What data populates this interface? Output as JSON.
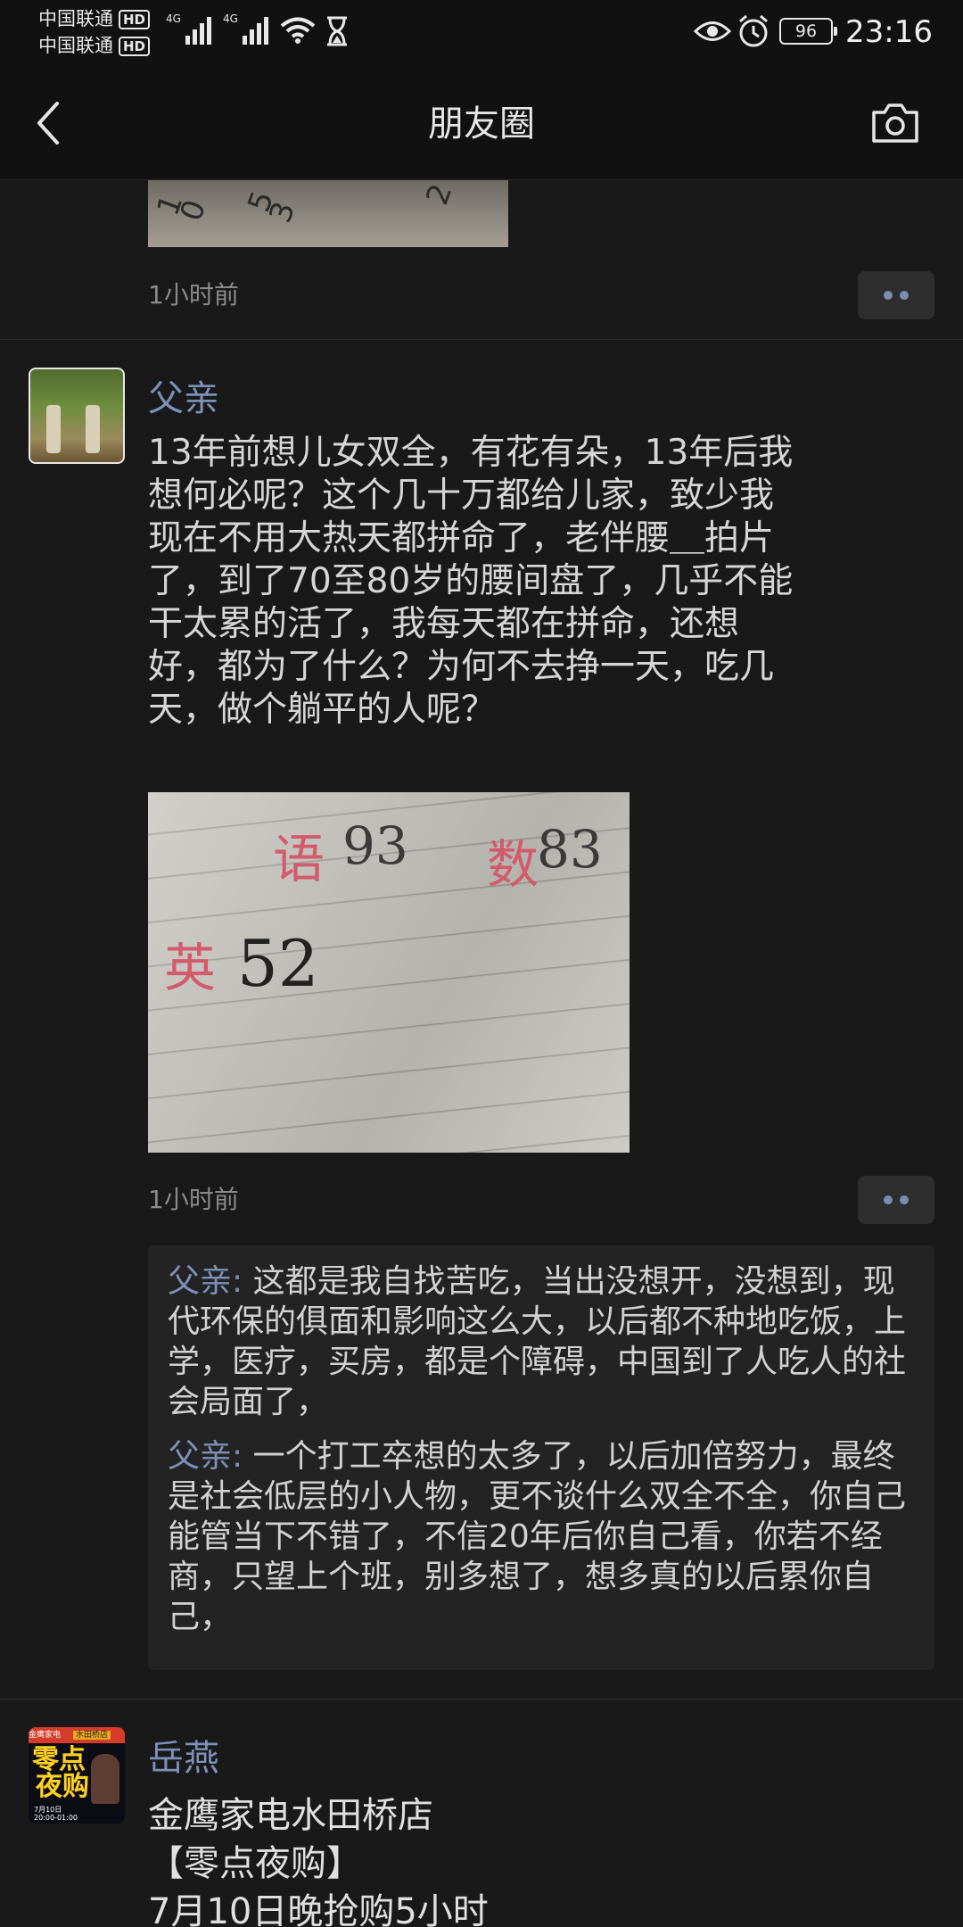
{
  "status_bar": {
    "carrier1": "中国联通",
    "carrier2": "中国联通",
    "hd": "HD",
    "network": "4G",
    "battery": "96",
    "time": "23:16"
  },
  "header": {
    "title": "朋友圈",
    "back_icon": "chevron-left-icon",
    "camera_icon": "camera-icon"
  },
  "prev_post": {
    "time": "1小时前",
    "digits": [
      "1",
      "0",
      "5",
      "3",
      "2"
    ]
  },
  "post": {
    "author": "父亲",
    "text": "13年前想儿女双全，有花有朵，13年后我\n想何必呢？这个几十万都给儿家，致少我\n现在不用大热天都拼命了，老伴腰＿拍片\n了，到了70至80岁的腰间盘了，几乎不能\n干太累的活了，我每天都在拼命，还想\n好，都为了什么？为何不去挣一天，吃几\n天，做个躺平的人呢？",
    "photo_text": {
      "yu": "语",
      "yu_score": "93",
      "shu": "数",
      "shu_score": "83",
      "ying": "英",
      "ying_score": "52"
    },
    "time": "1小时前",
    "comments": [
      {
        "name": "父亲",
        "sep": ": ",
        "text": "这都是我自找苦吃，当出没想开，没想到，现代环保的俱面和影响这么大，以后都不种地吃饭，上学，医疗，买房，都是个障碍，中国到了人吃人的社会局面了，"
      },
      {
        "name": "父亲",
        "sep": ": ",
        "text": "一个打工卒想的太多了，以后加倍努力，最终是社会低层的小人物，更不谈什么双全不全，你自己能管当下不错了，不信20年后你自己看，你若不经商，只望上个班，别多想了，想多真的以后累你自己，"
      }
    ]
  },
  "ad_post": {
    "author": "岳燕",
    "text": "金鹰家电水田桥店\n【零点夜购】\n7月10日晚抢购5小时",
    "avatar": {
      "top_left": "金鹰家电",
      "top_right": "水田桥店",
      "main1": "零点",
      "main2": "夜购",
      "date": "7月10日",
      "hours": "20:00-01:00"
    }
  },
  "colors": {
    "accent_name": "#7d90b8",
    "background": "#191919",
    "bar": "#111111"
  }
}
